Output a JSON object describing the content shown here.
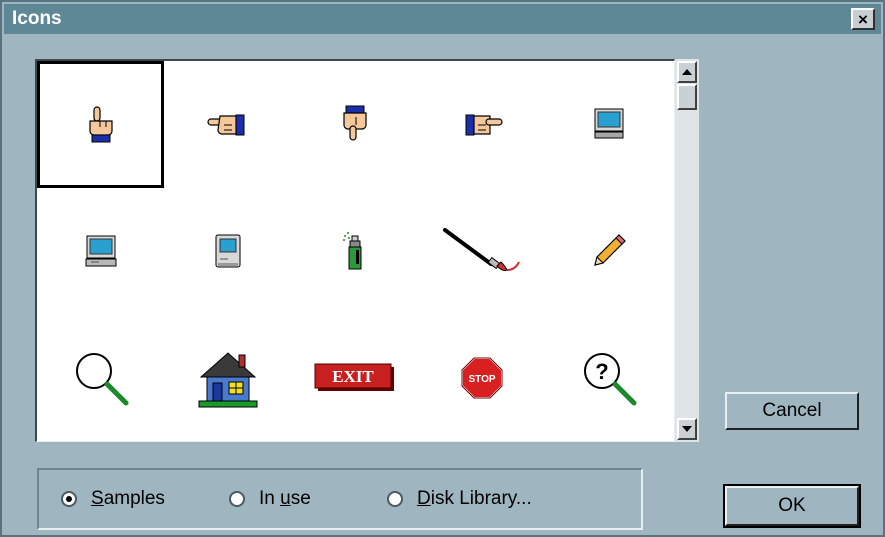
{
  "window": {
    "title": "Icons",
    "close_glyph": "×"
  },
  "icons": [
    {
      "name": "hand-point-up-icon",
      "selected": true
    },
    {
      "name": "hand-point-left-icon"
    },
    {
      "name": "hand-point-down-icon"
    },
    {
      "name": "hand-point-right-icon"
    },
    {
      "name": "computer-monitor-icon"
    },
    {
      "name": "computer-terminal-icon"
    },
    {
      "name": "macintosh-computer-icon"
    },
    {
      "name": "spray-can-icon"
    },
    {
      "name": "paint-brush-icon"
    },
    {
      "name": "pencil-icon"
    },
    {
      "name": "magnifying-glass-icon"
    },
    {
      "name": "house-icon",
      "label": ""
    },
    {
      "name": "exit-sign-icon",
      "label": "EXIT"
    },
    {
      "name": "stop-sign-icon",
      "label": "STOP"
    },
    {
      "name": "help-magnifier-icon",
      "label": "?"
    }
  ],
  "buttons": {
    "cancel": "Cancel",
    "ok": "OK"
  },
  "radios": [
    {
      "first": "S",
      "rest": "amples",
      "selected": true
    },
    {
      "before": "In ",
      "key": "u",
      "after": "se",
      "selected": false
    },
    {
      "first": "D",
      "rest": "isk Library...",
      "selected": false
    }
  ],
  "colors": {
    "dialog_bg": "#9fb5bf",
    "titlebar": "#5f8896",
    "panel": "#ffffff"
  }
}
